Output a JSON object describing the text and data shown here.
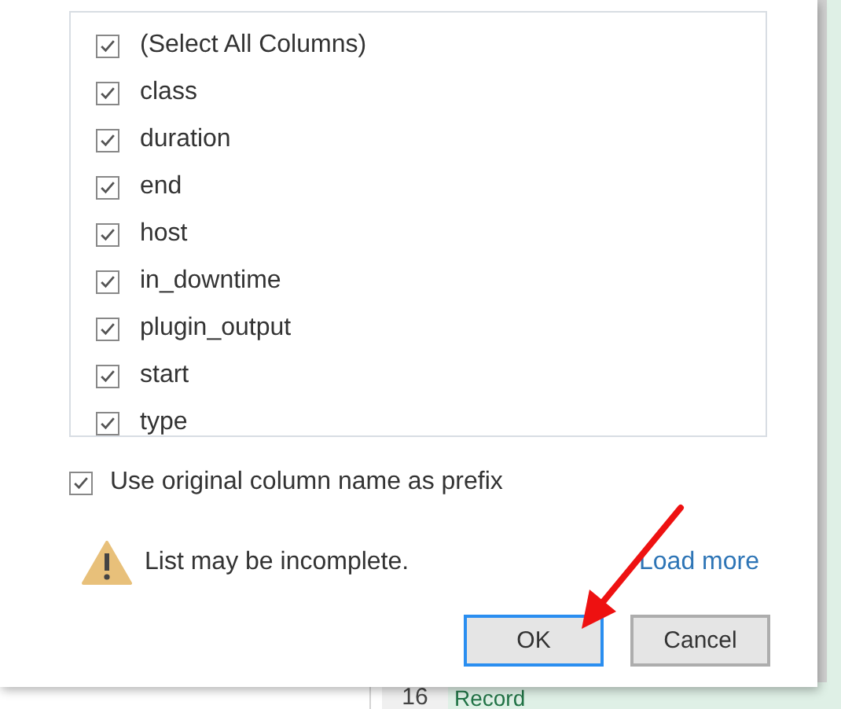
{
  "columns": [
    {
      "label": "(Select All Columns)",
      "checked": true
    },
    {
      "label": "class",
      "checked": true
    },
    {
      "label": "duration",
      "checked": true
    },
    {
      "label": "end",
      "checked": true
    },
    {
      "label": "host",
      "checked": true
    },
    {
      "label": "in_downtime",
      "checked": true
    },
    {
      "label": "plugin_output",
      "checked": true
    },
    {
      "label": "start",
      "checked": true
    },
    {
      "label": "type",
      "checked": true
    }
  ],
  "prefix_option": {
    "label": "Use original column name as prefix",
    "checked": true
  },
  "warning": {
    "text": "List may be incomplete.",
    "link": "Load more"
  },
  "buttons": [
    {
      "label": "OK",
      "default": true
    },
    {
      "label": "Cancel",
      "default": false
    }
  ],
  "sheet_row": {
    "number": "16",
    "cell": "Record"
  }
}
